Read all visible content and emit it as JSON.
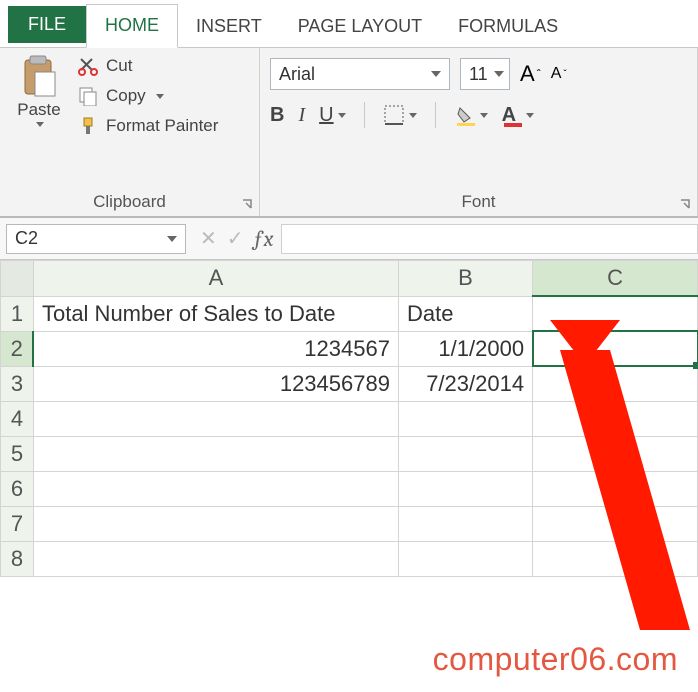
{
  "tabs": {
    "file": "FILE",
    "home": "HOME",
    "insert": "INSERT",
    "page_layout": "PAGE LAYOUT",
    "formulas": "FORMULAS"
  },
  "clipboard": {
    "paste": "Paste",
    "cut": "Cut",
    "copy": "Copy",
    "format_painter": "Format Painter",
    "group_label": "Clipboard"
  },
  "font": {
    "name": "Arial",
    "size": "11",
    "bold": "B",
    "italic": "I",
    "underline": "U",
    "group_label": "Font",
    "grow": "A",
    "shrink": "A"
  },
  "namebox": "C2",
  "columns": {
    "A": "A",
    "B": "B",
    "C": "C"
  },
  "rows": [
    "1",
    "2",
    "3",
    "4",
    "5",
    "6",
    "7",
    "8"
  ],
  "data": {
    "A1": "Total Number of Sales to Date",
    "B1": "Date",
    "A2": "1234567",
    "B2": "1/1/2000",
    "A3": "123456789",
    "B3": "7/23/2014"
  },
  "watermark": "computer06.com"
}
